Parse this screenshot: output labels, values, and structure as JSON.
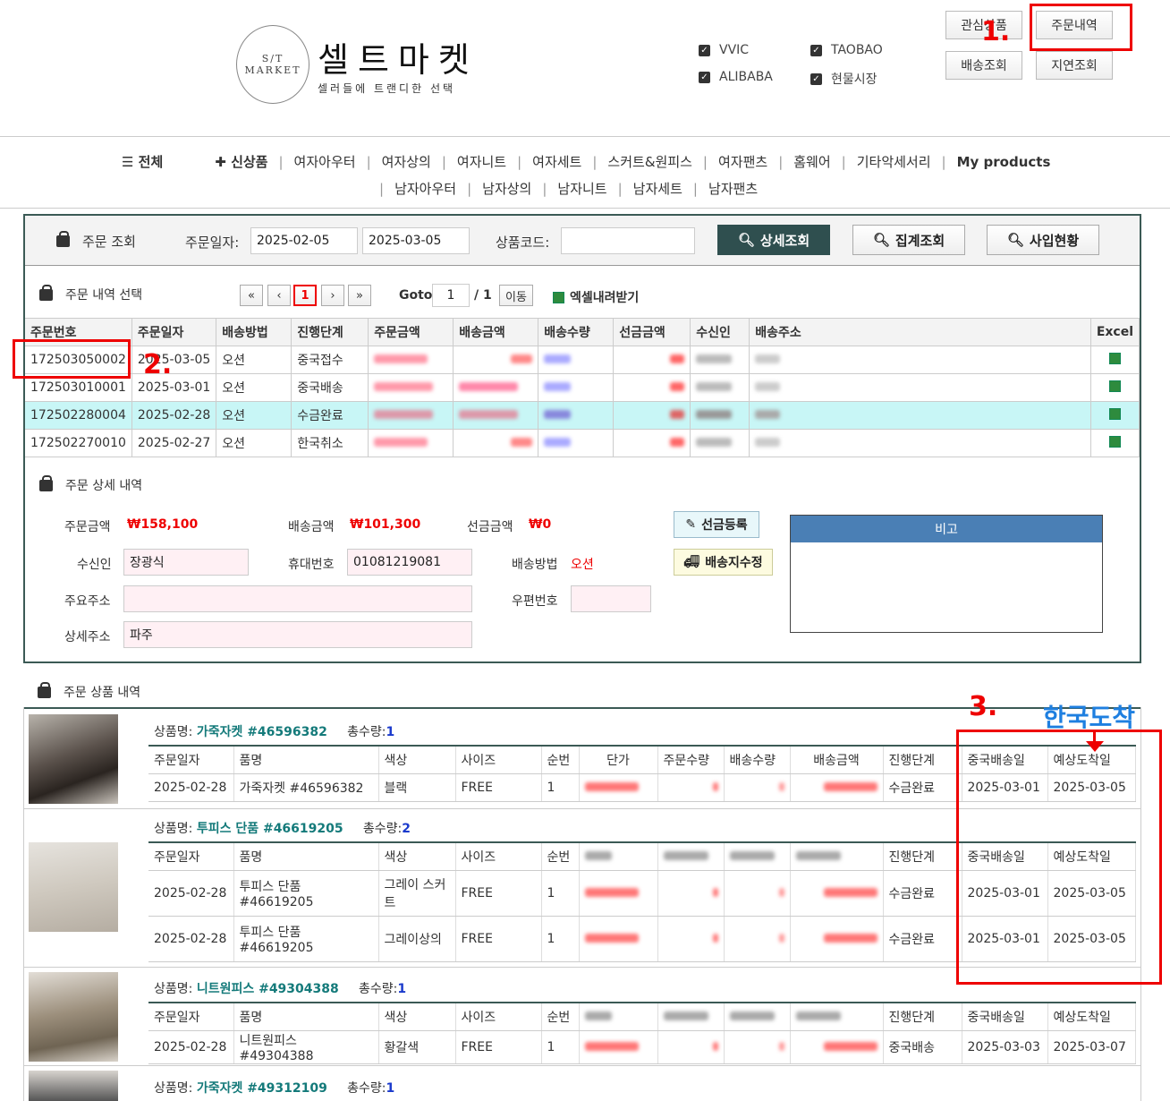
{
  "header": {
    "logo_line1": "S/T",
    "logo_line2": "MARKET",
    "logo_title": "셀트마켓",
    "logo_sub": "셀러들에 트랜디한 선택",
    "sources": [
      "VVIC",
      "TAOBAO",
      "ALIBABA",
      "현물시장"
    ],
    "buttons": {
      "wishlist": "관심상품",
      "orders": "주문내역",
      "shipping": "배송조회",
      "delay": "지연조회"
    }
  },
  "annotations": {
    "one": "1.",
    "two": "2.",
    "three": "3.",
    "korea_arrival": "한국도착"
  },
  "nav": {
    "row1": [
      "☰ 전체",
      "✚ 신상품",
      "여자아우터",
      "여자상의",
      "여자니트",
      "여자세트",
      "스커트&원피스",
      "여자팬츠",
      "홈웨어",
      "기타악세서리",
      "My products"
    ],
    "row2": [
      "남자아우터",
      "남자상의",
      "남자니트",
      "남자세트",
      "남자팬츠"
    ]
  },
  "search": {
    "title": "주문 조회",
    "date_label": "주문일자:",
    "date_from": "2025-02-05",
    "date_to": "2025-03-05",
    "code_label": "상품코드:",
    "code_value": "",
    "btn_detail": "상세조회",
    "btn_sum": "집계조회",
    "btn_purchase": "사입현황"
  },
  "order_list": {
    "title": "주문 내역 선택",
    "pager": {
      "first": "«",
      "prev": "‹",
      "current": "1",
      "next": "›",
      "last": "»",
      "goto_label": "Goto",
      "goto_value": "1",
      "total": "/ 1",
      "move": "이동",
      "excel": "엑셀내려받기"
    },
    "columns": [
      "주문번호",
      "주문일자",
      "배송방법",
      "진행단계",
      "주문금액",
      "배송금액",
      "배송수량",
      "선금금액",
      "수신인",
      "배송주소",
      "Excel"
    ],
    "rows": [
      {
        "no": "172503050002",
        "date": "2025-03-05",
        "method": "오션",
        "stage": "중국접수"
      },
      {
        "no": "172503010001",
        "date": "2025-03-01",
        "method": "오션",
        "stage": "중국배송"
      },
      {
        "no": "172502280004",
        "date": "2025-02-28",
        "method": "오션",
        "stage": "수금완료"
      },
      {
        "no": "172502270010",
        "date": "2025-02-27",
        "method": "오션",
        "stage": "한국취소"
      }
    ]
  },
  "detail": {
    "title": "주문 상세 내역",
    "order_amount_label": "주문금액",
    "order_amount": "₩158,100",
    "ship_amount_label": "배송금액",
    "ship_amount": "₩101,300",
    "prepay_label": "선금금액",
    "prepay": "₩0",
    "btn_prepay": "선금등록",
    "btn_edit": "배송지수정",
    "receiver_label": "수신인",
    "receiver": "장광식",
    "phone_label": "휴대번호",
    "phone": "01081219081",
    "method_label": "배송방법",
    "method": "오션",
    "addr_label": "주요주소",
    "addr": "",
    "zip_label": "우편번호",
    "zip": "",
    "addr2_label": "상세주소",
    "addr2": "파주",
    "memo_title": "비고"
  },
  "products": {
    "title": "주문 상품 내역",
    "name_label": "상품명:",
    "qty_label": "총수량:",
    "columns": [
      "주문일자",
      "품명",
      "색상",
      "사이즈",
      "순번",
      "단가",
      "주문수량",
      "배송수량",
      "배송금액",
      "진행단계",
      "중국배송일",
      "예상도착일"
    ],
    "items": [
      {
        "name": "가죽자켓 #46596382",
        "qty": "1",
        "rows": [
          {
            "date": "2025-02-28",
            "item": "가죽자켓 #46596382",
            "color": "블랙",
            "size": "FREE",
            "seq": "1",
            "stage": "수금완료",
            "cn": "2025-03-01",
            "eta": "2025-03-05"
          }
        ]
      },
      {
        "name": "투피스 단품 #46619205",
        "qty": "2",
        "rows": [
          {
            "date": "2025-02-28",
            "item": "투피스 단품 #46619205",
            "color": "그레이 스커트",
            "size": "FREE",
            "seq": "1",
            "stage": "수금완료",
            "cn": "2025-03-01",
            "eta": "2025-03-05"
          },
          {
            "date": "2025-02-28",
            "item": "투피스 단품 #46619205",
            "color": "그레이상의",
            "size": "FREE",
            "seq": "1",
            "stage": "수금완료",
            "cn": "2025-03-01",
            "eta": "2025-03-05"
          }
        ]
      },
      {
        "name": "니트원피스 #49304388",
        "qty": "1",
        "rows": [
          {
            "date": "2025-02-28",
            "item": "니트원피스 #49304388",
            "color": "황갈색",
            "size": "FREE",
            "seq": "1",
            "stage": "중국배송",
            "cn": "2025-03-03",
            "eta": "2025-03-07"
          }
        ]
      },
      {
        "name": "가죽자켓 #49312109",
        "qty": "1",
        "rows": []
      }
    ]
  }
}
